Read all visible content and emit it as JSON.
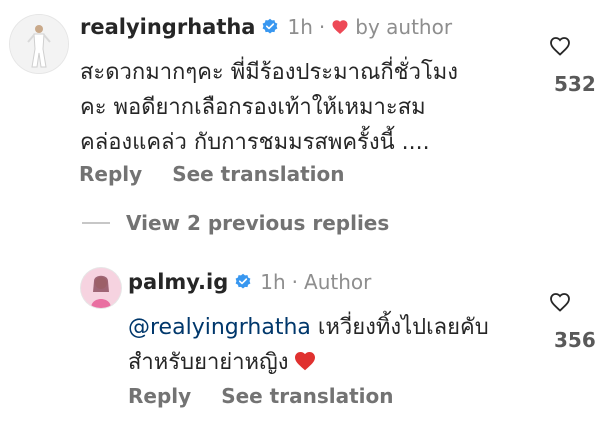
{
  "comment": {
    "username": "realyingrhatha",
    "time": "1h",
    "by_author": "by author",
    "lines": [
      "สะดวกมากๆคะ พี่มีร้องประมาณกี่ชั่วโมง",
      "คะ พอดียากเลือกรองเท้าให้เหมาะสม",
      "คล่องแคล่ว กับการชมมรสพครั้งนี้ ...."
    ],
    "like_count": "532",
    "reply_label": "Reply",
    "translate_label": "See translation"
  },
  "view_replies": "View 2 previous replies",
  "reply": {
    "username": "palmy.ig",
    "time": "1h",
    "author_label": "Author",
    "mention": "@realyingrhatha",
    "line1_rest": " เหวี่ยงทิ้งไปเลยคับ",
    "line2": "สำหรับยาย่าหญิง",
    "like_count": "356",
    "reply_label": "Reply",
    "translate_label": "See translation"
  },
  "colors": {
    "verified": "#3897f0",
    "heart_red": "#ed4956",
    "text": "#262626",
    "muted": "#8e8e8e"
  },
  "icons": [
    "verified-badge-icon",
    "heart-filled-icon",
    "heart-outline-icon"
  ]
}
